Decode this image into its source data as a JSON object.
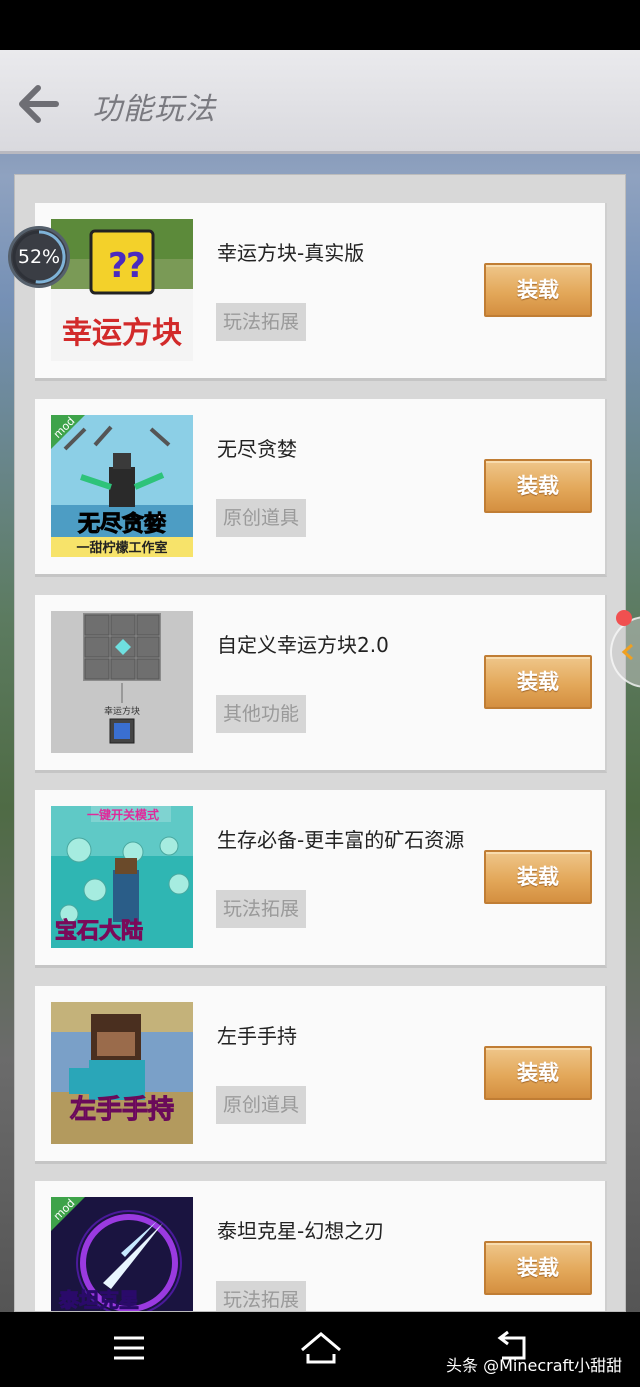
{
  "header": {
    "title": "功能玩法"
  },
  "progress": {
    "label": "52%",
    "value": 0.52
  },
  "items": [
    {
      "title": "幸运方块-真实版",
      "tag": "玩法拓展",
      "button": "装载",
      "thumb_text": "幸运方块"
    },
    {
      "title": "无尽贪婪",
      "tag": "原创道具",
      "button": "装载",
      "thumb_text": "无尽贪婪",
      "thumb_sub": "一甜柠檬工作室",
      "thumb_badge": "mod"
    },
    {
      "title": "自定义幸运方块2.0",
      "tag": "其他功能",
      "button": "装载",
      "thumb_text": "幸运方块"
    },
    {
      "title": "生存必备-更丰富的矿石资源",
      "tag": "玩法拓展",
      "button": "装载",
      "thumb_text": "宝石大陆",
      "thumb_sub": "一键开关模式"
    },
    {
      "title": "左手手持",
      "tag": "原创道具",
      "button": "装载",
      "thumb_text": "左手手持"
    },
    {
      "title": "泰坦克星-幻想之刃",
      "tag": "玩法拓展",
      "button": "装载",
      "thumb_text": "泰坦克星",
      "thumb_badge": "mod"
    }
  ],
  "watermark": "头条 @Minecraft小甜甜",
  "colors": {
    "button": "#e3a85a",
    "tag_bg": "#d6d6d6",
    "panel_bg": "#d8d8d8"
  }
}
